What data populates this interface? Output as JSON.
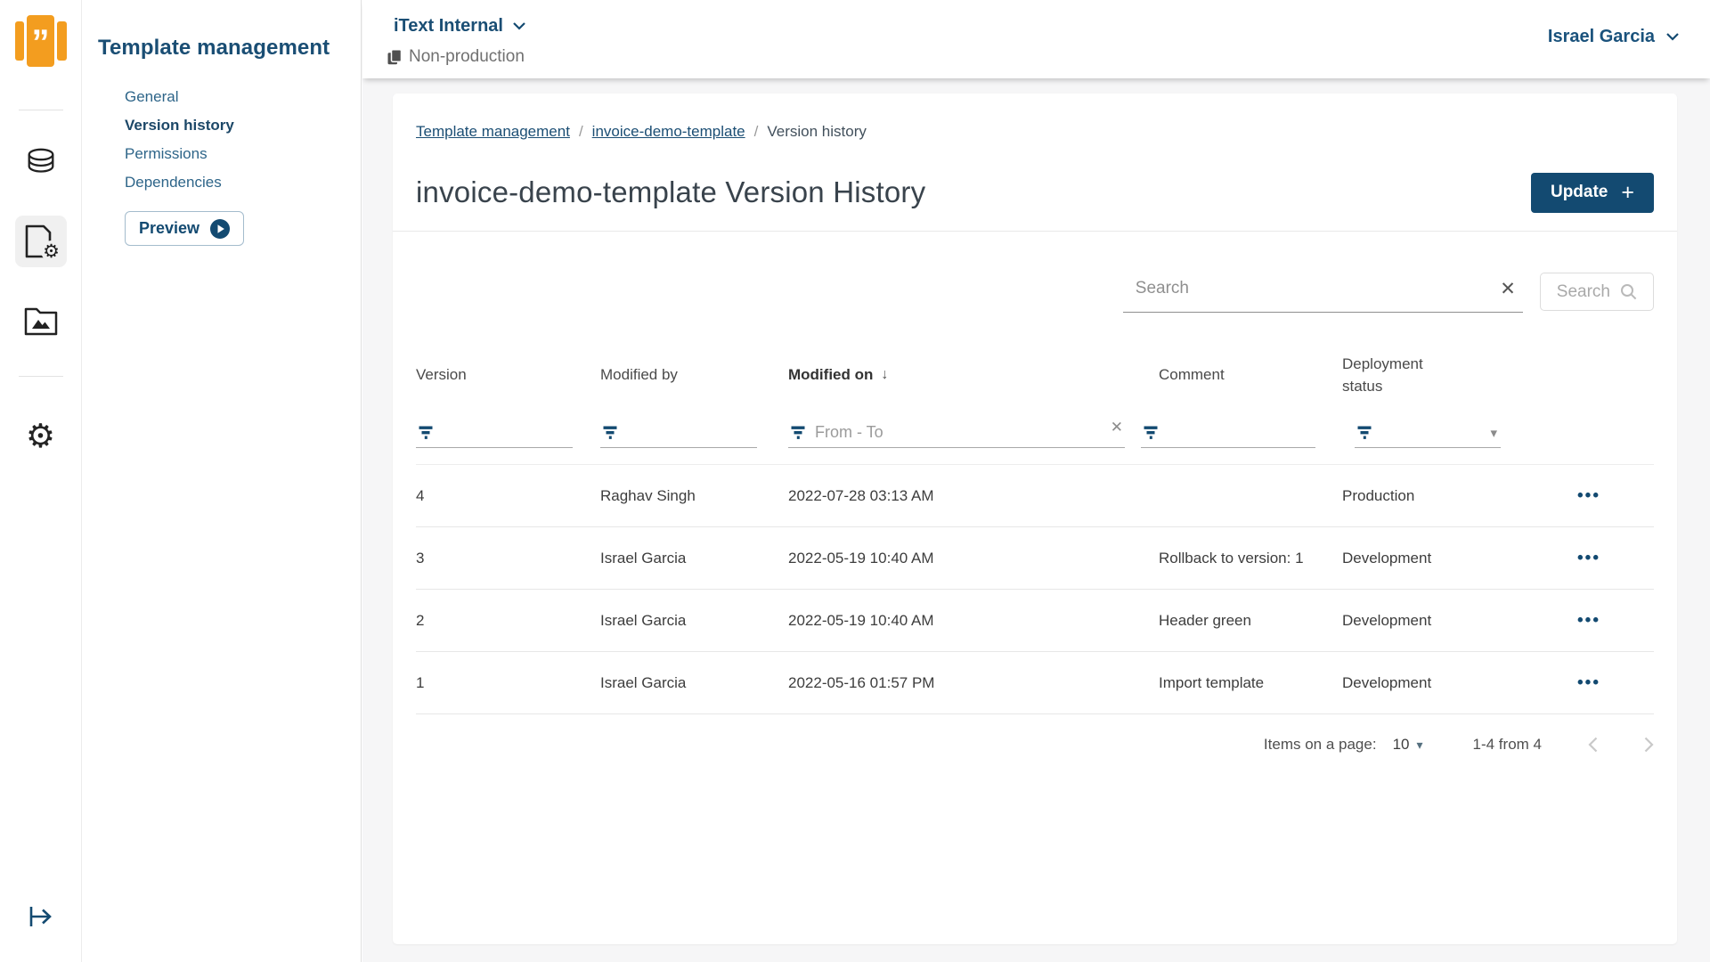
{
  "colors": {
    "accent": "#134a71",
    "orange": "#f39d1f",
    "link_blue": "#2e6589",
    "heading_navy": "#1a4e74"
  },
  "icons": {
    "quote_glyph": "”",
    "gear_glyph": "⚙",
    "clear_glyph": "✕",
    "sort_desc_glyph": "↓",
    "dropdown_glyph": "▾",
    "ellipsis_glyph": "•••",
    "plus_glyph": "+"
  },
  "sidebar": {
    "title": "Template management",
    "items": [
      {
        "label": "General",
        "active": false
      },
      {
        "label": "Version history",
        "active": true
      },
      {
        "label": "Permissions",
        "active": false
      },
      {
        "label": "Dependencies",
        "active": false
      }
    ],
    "preview_label": "Preview"
  },
  "topbar": {
    "workspace": "iText Internal",
    "environment": "Non-production",
    "user": "Israel Garcia"
  },
  "main": {
    "breadcrumb": [
      {
        "label": "Template management",
        "link": true
      },
      {
        "label": "invoice-demo-template",
        "link": true
      },
      {
        "label": "Version history",
        "link": false
      }
    ],
    "breadcrumb_separator": "/",
    "title": "invoice-demo-template Version History",
    "update_button": "Update",
    "search": {
      "placeholder": "Search",
      "button_label": "Search"
    },
    "table": {
      "columns": [
        "Version",
        "Modified by",
        "Modified on",
        "Comment",
        "Deployment status"
      ],
      "sorted_column": "Modified on",
      "date_filter_placeholder": "From - To",
      "rows": [
        {
          "version": "4",
          "modified_by": "Raghav Singh",
          "modified_on": "2022-07-28 03:13 AM",
          "comment": "",
          "status": "Production"
        },
        {
          "version": "3",
          "modified_by": "Israel Garcia",
          "modified_on": "2022-05-19 10:40 AM",
          "comment": "Rollback to version: 1",
          "status": "Development"
        },
        {
          "version": "2",
          "modified_by": "Israel Garcia",
          "modified_on": "2022-05-19 10:40 AM",
          "comment": "Header green",
          "status": "Development"
        },
        {
          "version": "1",
          "modified_by": "Israel Garcia",
          "modified_on": "2022-05-16 01:57 PM",
          "comment": "Import template",
          "status": "Development"
        }
      ]
    },
    "pagination": {
      "items_label": "Items on a page:",
      "page_size": "10",
      "range": "1-4 from 4"
    }
  }
}
